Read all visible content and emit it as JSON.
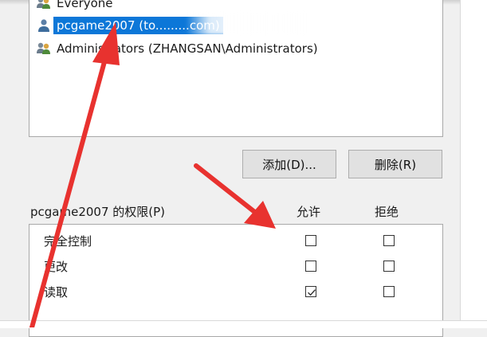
{
  "group_list": {
    "items": [
      {
        "label": "Everyone",
        "selected": false
      },
      {
        "label": "pcgame2007 (to.........com)",
        "selected": true
      },
      {
        "label": "Administrators (ZHANGSAN\\Administrators)",
        "selected": false
      }
    ]
  },
  "buttons": {
    "add_label": "添加(D)...",
    "remove_label": "删除(R)"
  },
  "permissions": {
    "title": "pcgame2007 的权限(P)",
    "allow_header": "允许",
    "deny_header": "拒绝",
    "rows": [
      {
        "label": "完全控制",
        "allow": false,
        "deny": false
      },
      {
        "label": "更改",
        "allow": false,
        "deny": false
      },
      {
        "label": "读取",
        "allow": true,
        "deny": false
      }
    ]
  },
  "colors": {
    "selection": "#0c77d8",
    "annotation_arrow": "#e8322f"
  }
}
